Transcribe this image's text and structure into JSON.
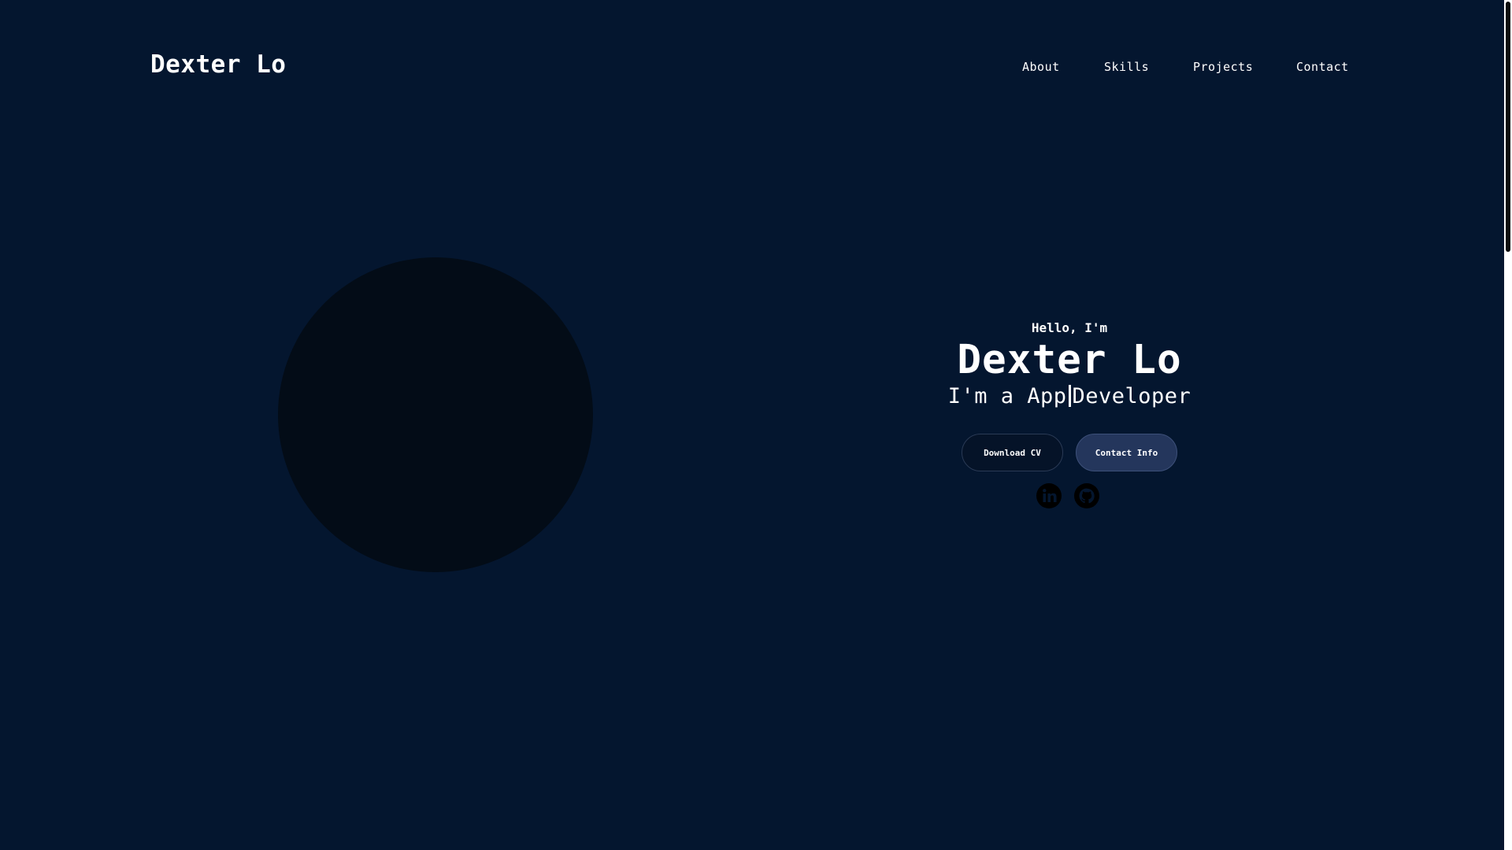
{
  "header": {
    "logo": "Dexter Lo",
    "nav": [
      "About",
      "Skills",
      "Projects",
      "Contact"
    ]
  },
  "hero": {
    "greeting": "Hello, I'm",
    "name": "Dexter Lo",
    "role_prefix": "I'm a App",
    "role_suffix": "Developer",
    "buttons": {
      "download_cv": "Download CV",
      "contact_info": "Contact Info"
    },
    "social_icons": [
      "linkedin-icon",
      "github-icon"
    ]
  },
  "colors": {
    "background": "#04162f",
    "avatar": "#030c17",
    "contact_button": "#24365c",
    "download_button": "#051328"
  }
}
